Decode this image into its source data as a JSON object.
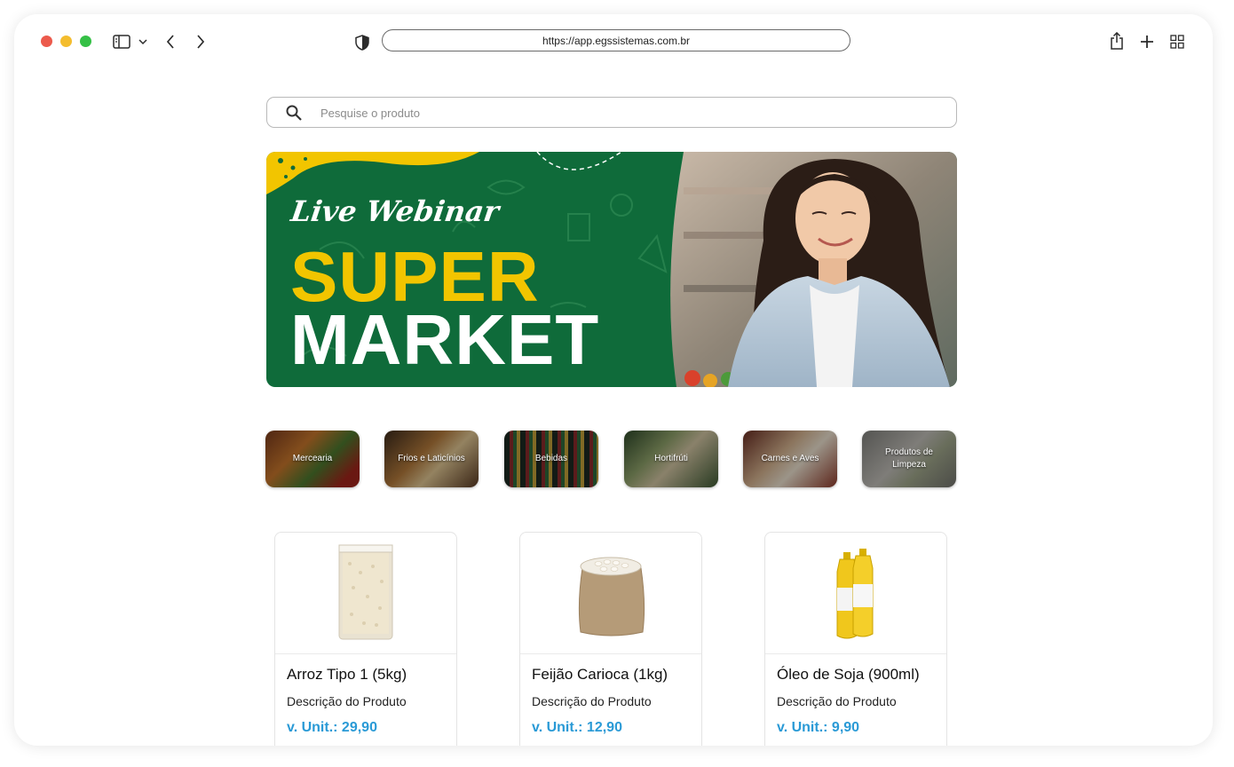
{
  "browser": {
    "url": "https://app.egssistemas.com.br"
  },
  "search": {
    "placeholder": "Pesquise o produto"
  },
  "banner": {
    "line1": "Live Webinar",
    "line2": "SUPER",
    "line3": "MARKET"
  },
  "categories": [
    {
      "label": "Mercearia"
    },
    {
      "label": "Frios e Laticínios"
    },
    {
      "label": "Bebidas"
    },
    {
      "label": "Hortifrúti"
    },
    {
      "label": "Carnes e Aves"
    },
    {
      "label": "Produtos de Limpeza"
    }
  ],
  "products": [
    {
      "name": "Arroz Tipo 1 (5kg)",
      "description": "Descrição do Produto",
      "price": "v. Unit.: 29,90"
    },
    {
      "name": "Feijão Carioca (1kg)",
      "description": "Descrição do Produto",
      "price": "v. Unit.:  12,90"
    },
    {
      "name": "Óleo de Soja (900ml)",
      "description": "Descrição do Produto",
      "price": "v. Unit.: 9,90"
    }
  ],
  "colors": {
    "banner_green": "#0f6b3a",
    "banner_yellow": "#f2c500",
    "price_blue": "#2a9ad6",
    "traffic_red": "#ec5a4c",
    "traffic_yellow": "#f4bd2e",
    "traffic_green": "#35c046"
  }
}
